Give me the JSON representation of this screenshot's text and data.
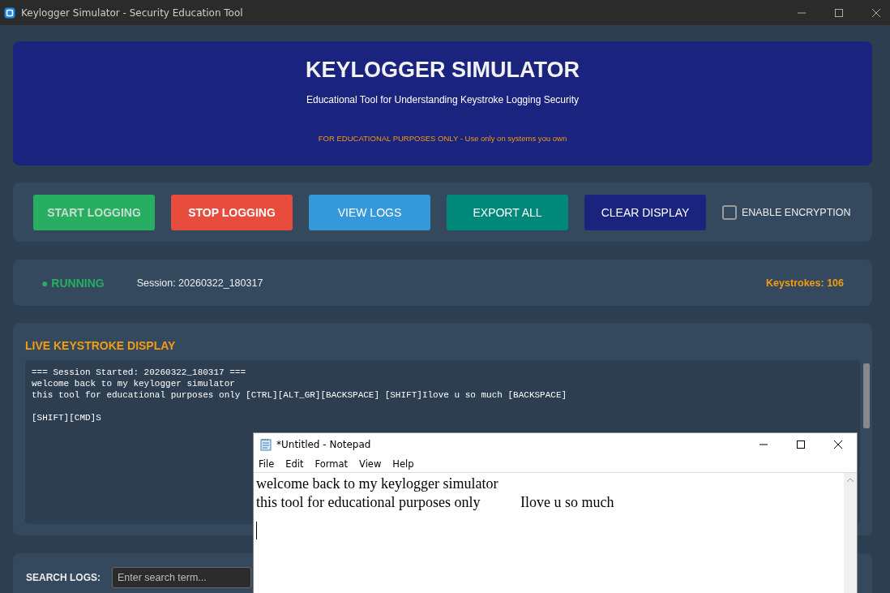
{
  "window": {
    "title": "Keylogger Simulator - Security Education Tool"
  },
  "header": {
    "title": "KEYLOGGER SIMULATOR",
    "subtitle": "Educational Tool for Understanding Keystroke Logging Security",
    "warning": "FOR EDUCATIONAL PURPOSES ONLY - Use only on systems you own"
  },
  "buttons": [
    {
      "label": "START LOGGING",
      "color": "#27ae60",
      "bold": true,
      "disabled": true
    },
    {
      "label": "STOP LOGGING",
      "color": "#e74c3c",
      "bold": true,
      "disabled": false
    },
    {
      "label": "VIEW LOGS",
      "color": "#3498db",
      "bold": false,
      "disabled": false
    },
    {
      "label": "EXPORT ALL",
      "color": "#00897b",
      "bold": false,
      "disabled": false
    },
    {
      "label": "CLEAR DISPLAY",
      "color": "#1a237e",
      "bold": false,
      "disabled": false
    }
  ],
  "encryption": {
    "label": "ENABLE ENCRYPTION",
    "checked": false
  },
  "status": {
    "state": "● RUNNING",
    "session": "Session: 20260322_180317",
    "keystrokes": "Keystrokes: 106"
  },
  "live_display": {
    "title": "LIVE KEYSTROKE DISPLAY",
    "paragraphs": [
      [
        "=== Session Started: 20260322_180317 ===",
        "welcome back to my keylogger simulator",
        "this tool for educational purposes only [CTRL][ALT_GR][BACKSPACE] [SHIFT]Ilove u so much [BACKSPACE]"
      ],
      [
        "[SHIFT][CMD]S"
      ]
    ]
  },
  "search": {
    "label": "SEARCH LOGS:",
    "placeholder": "Enter search term..."
  },
  "notepad": {
    "title": "*Untitled - Notepad",
    "menu": [
      "File",
      "Edit",
      "Format",
      "View",
      "Help"
    ],
    "lines": [
      "welcome back to my keylogger simulator",
      "this tool for educational purposes only           Ilove u so much"
    ]
  }
}
